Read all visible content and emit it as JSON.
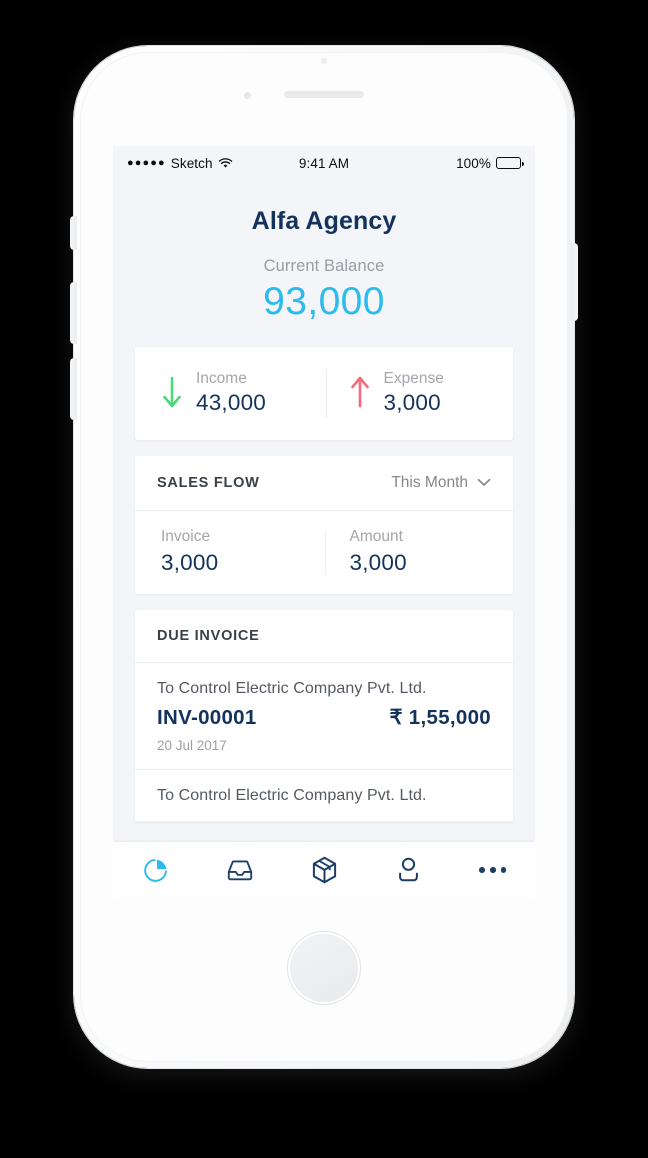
{
  "status_bar": {
    "signal_dots": "●●●●●",
    "carrier": "Sketch",
    "wifi_icon": "wifi-icon",
    "time": "9:41 AM",
    "battery_percent": "100%",
    "battery_icon": "battery-full-icon"
  },
  "header": {
    "app_title": "Alfa Agency",
    "balance_label": "Current Balance",
    "balance_value": "93,000"
  },
  "summary": {
    "income": {
      "icon": "arrow-down-icon",
      "label": "Income",
      "value": "43,000",
      "color": "#4CD97B"
    },
    "expense": {
      "icon": "arrow-up-icon",
      "label": "Expense",
      "value": "3,000",
      "color": "#F56A76"
    }
  },
  "sales_flow": {
    "title": "SALES FLOW",
    "filter_label": "This Month",
    "filter_icon": "chevron-down-icon",
    "metrics": [
      {
        "label": "Invoice",
        "value": "3,000"
      },
      {
        "label": "Amount",
        "value": "3,000"
      }
    ]
  },
  "due_invoice": {
    "title": "DUE INVOICE",
    "items": [
      {
        "to": "To Control Electric Company Pvt. Ltd.",
        "invoice_no": "INV-00001",
        "amount": "₹ 1,55,000",
        "date": "20 Jul 2017"
      },
      {
        "to": "To Control Electric Company Pvt. Ltd.",
        "invoice_no": "",
        "amount": "",
        "date": ""
      }
    ]
  },
  "tab_bar": {
    "active_color": "#2BBBEC",
    "inactive_color": "#1C3F68",
    "tabs": [
      {
        "name": "pie-chart-icon",
        "active": true
      },
      {
        "name": "inbox-icon",
        "active": false
      },
      {
        "name": "package-icon",
        "active": false
      },
      {
        "name": "person-icon",
        "active": false
      },
      {
        "name": "more-icon",
        "active": false
      }
    ]
  },
  "colors": {
    "screen_bg": "#F4F5F9",
    "card_bg": "#FFFFFF",
    "navy": "#13325C",
    "cyan": "#2BBBEC",
    "gray_label": "#A3A6AC"
  }
}
